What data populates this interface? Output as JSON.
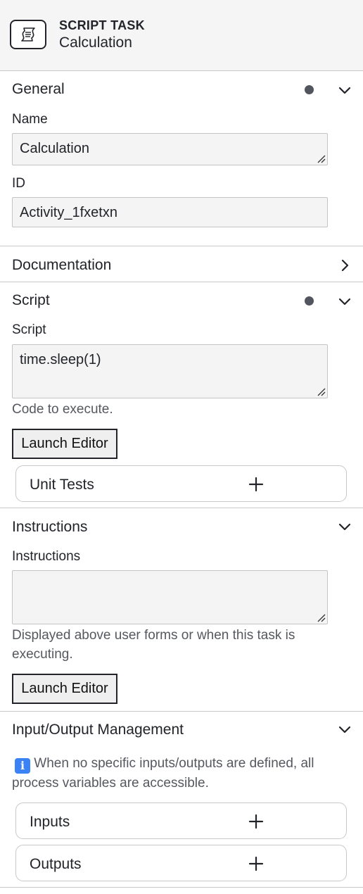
{
  "header": {
    "type_label": "SCRIPT TASK",
    "element_name": "Calculation",
    "icon": "script-task-icon"
  },
  "general": {
    "title": "General",
    "name_label": "Name",
    "name_value": "Calculation",
    "id_label": "ID",
    "id_value": "Activity_1fxetxn"
  },
  "documentation": {
    "title": "Documentation"
  },
  "script": {
    "title": "Script",
    "field_label": "Script",
    "field_value": "time.sleep(1)",
    "description": "Code to execute.",
    "launch_label": "Launch Editor",
    "unit_tests_label": "Unit Tests"
  },
  "instructions": {
    "title": "Instructions",
    "field_label": "Instructions",
    "field_value": "",
    "description": "Displayed above user forms or when this task is executing.",
    "launch_label": "Launch Editor"
  },
  "io": {
    "title": "Input/Output Management",
    "info_icon": "ℹ️",
    "info_text": "When no specific inputs/outputs are defined, all process variables are accessible.",
    "inputs_label": "Inputs",
    "outputs_label": "Outputs"
  },
  "colors": {
    "header_bg": "#f5f5f5",
    "dot": "#52555e",
    "field_bg": "#f4f4f4",
    "text": "#22242a",
    "muted_text": "#55585f"
  }
}
